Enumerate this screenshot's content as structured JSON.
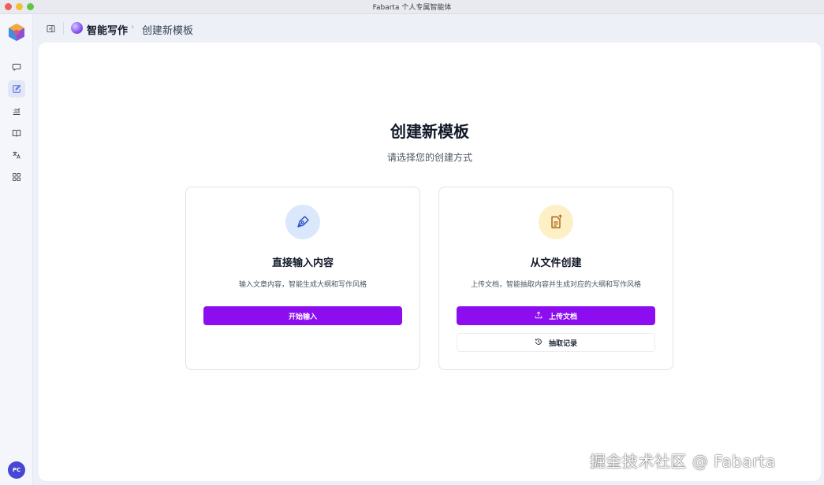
{
  "window": {
    "title": "Fabarta 个人专属智能体"
  },
  "sidebar": {
    "items": [
      {
        "icon": "chat-bubble-icon"
      },
      {
        "icon": "edit-document-icon",
        "active": true
      },
      {
        "icon": "bar-chart-icon"
      },
      {
        "icon": "book-icon"
      },
      {
        "icon": "translate-icon"
      },
      {
        "icon": "apps-grid-icon"
      }
    ],
    "avatar_initials": "PC"
  },
  "header": {
    "breadcrumb_parent": "智能写作",
    "breadcrumb_separator": "›",
    "breadcrumb_current": "创建新模板"
  },
  "main": {
    "title": "创建新模板",
    "subtitle": "请选择您的创建方式",
    "cards": [
      {
        "icon": "pen-nib-icon",
        "title": "直接输入内容",
        "description": "输入文章内容，智能生成大纲和写作风格",
        "primary_button": "开始输入"
      },
      {
        "icon": "document-upload-icon",
        "title": "从文件创建",
        "description": "上传文档，智能抽取内容并生成对应的大纲和写作风格",
        "primary_button": "上传文档",
        "secondary_button": "抽取记录"
      }
    ]
  },
  "watermark": "掘金技术社区 @ Fabarta",
  "colors": {
    "accent": "#8b0df0",
    "avatar": "#4747d6",
    "background": "#eef0f8"
  }
}
